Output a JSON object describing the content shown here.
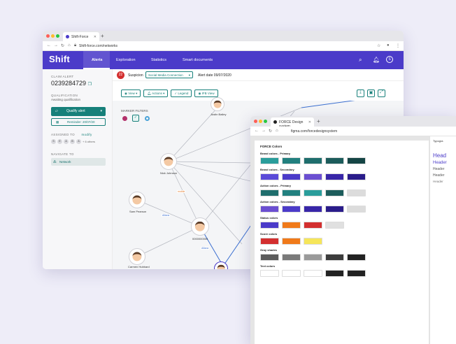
{
  "shift": {
    "tab_title": "Shift-Force",
    "url": "Shift-force.com/networks",
    "brand": "Shift",
    "nav": [
      "Alerts",
      "Exploration",
      "Statistics",
      "Smart documents"
    ],
    "user_initial": "S",
    "sidebar": {
      "claim_label": "CLAIM ALERT",
      "claim_id": "0239284729",
      "qualification_label": "QUALIFICATION",
      "qualification_value": "Awaiting qualification",
      "qualify_button": "Qualify alert",
      "reminder_button": "Reminder: 20/07/20",
      "assigned_label": "ASSIGNED TO",
      "modify_link": "modify",
      "assignees": [
        "S",
        "E",
        "A",
        "B",
        "A"
      ],
      "more_assignees": "+ 6 others",
      "navigate_label": "NAVIGATE TO",
      "network_item": "Network"
    },
    "subheader": {
      "count": "22",
      "suspicion_label": "Suspicion",
      "suspicion_value": "Social Media Connection",
      "alert_date": "Alert date 09/07/2020"
    },
    "toolbar": {
      "view": "View",
      "actions": "Actions",
      "legend": "Legend",
      "ifb_view": "IFB View"
    },
    "marker_filters": "MARKER FILTERS",
    "nodes": [
      "Justin Bailey",
      "Nick Johnson",
      "Sam Pearson",
      "0000000000",
      "Carmen Hubbard"
    ],
    "edge_labels": [
      "Allianz",
      "Allianz",
      "Allianz",
      "mobile"
    ],
    "colors": {
      "brand": "#4b3bc9",
      "teal": "#17807a",
      "alert": "#d32f2f"
    }
  },
  "figma": {
    "tab_title": "FORCE Design system",
    "url": "figma.com/forcedesignsystem",
    "page_title": "FORCE Colors",
    "sections": [
      {
        "name": "Brand colors - Primary",
        "colors": [
          "#2a9d9b",
          "#22807f",
          "#1f6e6d",
          "#1c5c5b",
          "#154545"
        ]
      },
      {
        "name": "Brand colors - Secondary",
        "colors": [
          "#5a4bd8",
          "#4b3bc9",
          "#6b4fd1",
          "#3826a8",
          "#2a1c8a"
        ]
      },
      {
        "name": "Action colors - Primary",
        "colors": [
          "#1f6e6d",
          "#22807f",
          "#2a9d9b",
          "#1c5c5b",
          "#dcdcdc"
        ]
      },
      {
        "name": "Action colors - Secondary",
        "colors": [
          "#6b4fd1",
          "#4b3bc9",
          "#3826a8",
          "#2a1c8a",
          "#dcdcdc"
        ]
      },
      {
        "name": "Status colors",
        "colors": [
          "#4b3bc9",
          "#f07a1a",
          "#d32f2f",
          "#e0e0e0"
        ]
      },
      {
        "name": "Score colors",
        "colors": [
          "#d32f2f",
          "#f07a1a",
          "#f6e65a"
        ]
      },
      {
        "name": "Gray shades",
        "colors": [
          "#5c5c5c",
          "#7a7a7a",
          "#9a9a9a",
          "#3c3c3c",
          "#222222"
        ]
      },
      {
        "name": "Text colors",
        "colors": [
          "#ffffff",
          "#ffffff",
          "#ffffff",
          "#222222",
          "#222222"
        ]
      }
    ],
    "panel_title": "Typogra",
    "panel_lines": [
      "Head",
      "Header",
      "Header",
      "Header",
      "Header"
    ]
  }
}
